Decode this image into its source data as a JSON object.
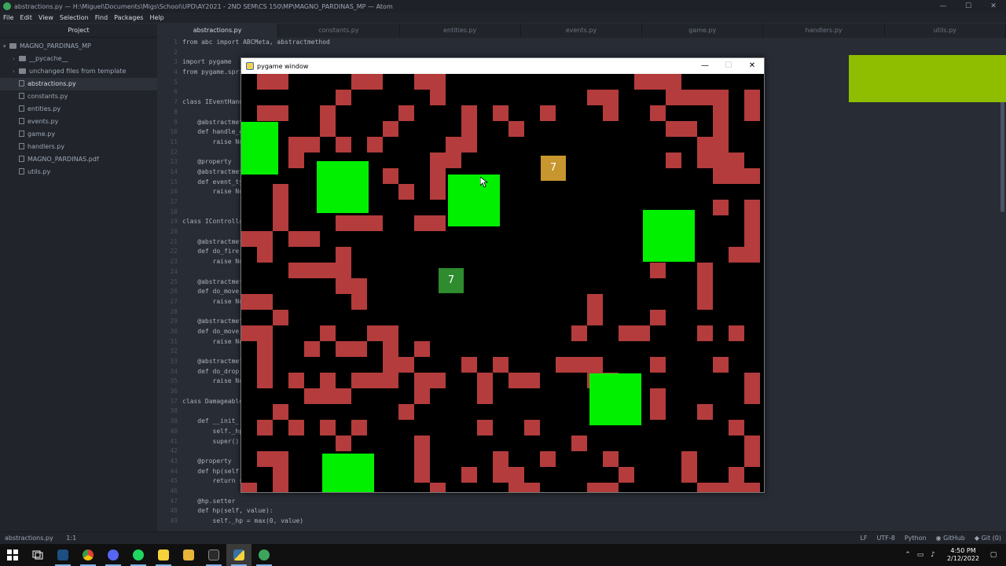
{
  "window": {
    "title": "abstractions.py — H:\\Miguel\\Documents\\Migs\\School\\UPD\\AY2021 - 2ND SEM\\CS 150\\MP\\MAGNO_PARDINAS_MP — Atom",
    "minimize": "—",
    "maximize": "☐",
    "close": "✕"
  },
  "menu": [
    "File",
    "Edit",
    "View",
    "Selection",
    "Find",
    "Packages",
    "Help"
  ],
  "tree": {
    "header": "Project",
    "root": "MAGNO_PARDINAS_MP",
    "items": [
      {
        "label": "__pycache__",
        "type": "folder"
      },
      {
        "label": "unchanged files from template",
        "type": "folder"
      },
      {
        "label": "abstractions.py",
        "type": "file",
        "selected": true
      },
      {
        "label": "constants.py",
        "type": "file"
      },
      {
        "label": "entities.py",
        "type": "file"
      },
      {
        "label": "events.py",
        "type": "file"
      },
      {
        "label": "game.py",
        "type": "file"
      },
      {
        "label": "handlers.py",
        "type": "file"
      },
      {
        "label": "MAGNO_PARDINAS.pdf",
        "type": "file"
      },
      {
        "label": "utils.py",
        "type": "file"
      }
    ]
  },
  "tabs": [
    "abstractions.py",
    "constants.py",
    "entities.py",
    "events.py",
    "game.py",
    "handlers.py",
    "utils.py"
  ],
  "editor": {
    "line_numbers": [
      "1",
      "2",
      "3",
      "4",
      "5",
      "6",
      "7",
      "8",
      "9",
      "10",
      "11",
      "12",
      "13",
      "14",
      "15",
      "16",
      "17",
      "18",
      "19",
      "20",
      "21",
      "22",
      "23",
      "24",
      "25",
      "26",
      "27",
      "28",
      "29",
      "30",
      "31",
      "32",
      "33",
      "34",
      "35",
      "36",
      "37",
      "38",
      "39",
      "40",
      "41",
      "42",
      "43",
      "44",
      "45",
      "46",
      "47",
      "48",
      "49"
    ],
    "lines": [
      "from abc import ABCMeta, abstractmethod",
      "",
      "import pygame",
      "from pygame.spri",
      "",
      "",
      "class IEventHand",
      "",
      "    @abstractmet",
      "    def handle_e",
      "        raise No",
      "",
      "    @property",
      "    @abstractmet",
      "    def event_ty",
      "        raise No",
      "",
      "",
      "class IControlla",
      "",
      "    @abstractmet",
      "    def do_fire_",
      "        raise No",
      "",
      "    @abstractmet",
      "    def do_move_",
      "        raise No",
      "",
      "    @abstractmet",
      "    def do_move_",
      "        raise No",
      "",
      "    @abstractmet",
      "    def do_drop_",
      "        raise No",
      "",
      "class Damageable",
      "",
      "    def __init_",
      "        self._hp",
      "        super().",
      "",
      "    @property",
      "    def hp(self)",
      "        return s",
      "",
      "    @hp.setter",
      "    def hp(self, value):",
      "        self._hp = max(0, value)"
    ]
  },
  "statusbar": {
    "file": "abstractions.py",
    "cursor": "1:1",
    "line_ending": "LF",
    "encoding": "UTF-8",
    "grammar": "Python",
    "github": "GitHub",
    "git": "Git (0)"
  },
  "pygame": {
    "title": "pygame window",
    "minimize": "—",
    "maximize": "☐",
    "close": "✕",
    "badges": [
      {
        "text": "7",
        "color": "#c8962e"
      },
      {
        "text": "7",
        "color": "#2e8b2e"
      }
    ],
    "colors": {
      "wall": "#b43c3c",
      "blob": "#00f000",
      "background": "#000000"
    }
  },
  "taskbar": {
    "time": "4:50 PM",
    "date": "2/12/2022",
    "icons": [
      "windows-start-icon",
      "task-view-icon",
      "steam-icon",
      "chrome-icon",
      "discord-icon",
      "spotify-icon",
      "sticky-notes-icon",
      "file-explorer-icon",
      "terminal-icon",
      "python-icon",
      "atom-icon"
    ]
  }
}
